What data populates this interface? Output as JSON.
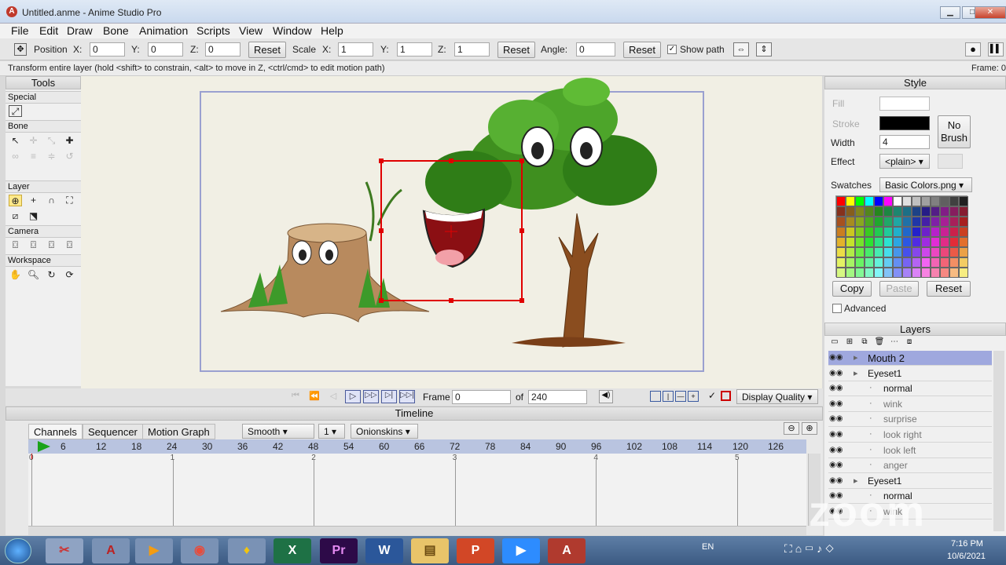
{
  "window": {
    "title": "Untitled.anme - Anime Studio Pro",
    "app_icon_letter": "A",
    "minimize": "▁",
    "maximize": "□",
    "close": "✕"
  },
  "menu": [
    "File",
    "Edit",
    "Draw",
    "Bone",
    "Animation",
    "Scripts",
    "View",
    "Window",
    "Help"
  ],
  "toolbar": {
    "position_label": "Position",
    "x_label": "X:",
    "x_value": "0",
    "y_label": "Y:",
    "y_value": "0",
    "z_label": "Z:",
    "z_value": "0",
    "reset1": "Reset",
    "scale_label": "Scale",
    "sx_label": "X:",
    "sx_value": "1",
    "sy_label": "Y:",
    "sy_value": "1",
    "sz_label": "Z:",
    "sz_value": "1",
    "reset2": "Reset",
    "angle_label": "Angle:",
    "angle_value": "0",
    "reset3": "Reset",
    "show_path": "Show path"
  },
  "status": {
    "hint": "Transform entire layer (hold <shift> to constrain, <alt> to move in Z, <ctrl/cmd> to edit motion path)",
    "frame": "Frame: 0"
  },
  "tools": {
    "title": "Tools",
    "sections": [
      "Special",
      "Bone",
      "Layer",
      "Camera",
      "Workspace"
    ]
  },
  "playback": {
    "frame_label": "Frame",
    "frame_value": "0",
    "of_label": "of",
    "total_value": "240",
    "display_quality": "Display Quality"
  },
  "timeline": {
    "title": "Timeline",
    "tabs": [
      "Channels",
      "Sequencer",
      "Motion Graph"
    ],
    "smooth": "Smooth",
    "step": "1",
    "onionskins": "Onionskins",
    "ruler": [
      "0",
      "6",
      "12",
      "18",
      "24",
      "30",
      "36",
      "42",
      "48",
      "54",
      "60",
      "66",
      "72",
      "78",
      "84",
      "90",
      "96",
      "102",
      "108",
      "114",
      "120",
      "126"
    ],
    "seconds": [
      "0",
      "1",
      "2",
      "3",
      "4",
      "5"
    ]
  },
  "style": {
    "title": "Style",
    "fill_label": "Fill",
    "stroke_label": "Stroke",
    "width_label": "Width",
    "width_value": "4",
    "effect_label": "Effect",
    "effect_value": "<plain>",
    "no_brush": "No Brush",
    "swatches_label": "Swatches",
    "swatches_value": "Basic Colors.png",
    "copy": "Copy",
    "paste": "Paste",
    "reset": "Reset",
    "advanced": "Advanced"
  },
  "layers": {
    "title": "Layers",
    "items": [
      {
        "label": "Mouth 2",
        "type": "group",
        "selected": true
      },
      {
        "label": "Eyeset1",
        "type": "switch"
      },
      {
        "label": "normal",
        "type": "vector",
        "active": true
      },
      {
        "label": "wink",
        "type": "vector"
      },
      {
        "label": "surprise",
        "type": "vector"
      },
      {
        "label": "look right",
        "type": "vector"
      },
      {
        "label": "look left",
        "type": "vector"
      },
      {
        "label": "anger",
        "type": "vector"
      },
      {
        "label": "Eyeset1",
        "type": "switch"
      },
      {
        "label": "normal",
        "type": "vector",
        "active": true
      },
      {
        "label": "wink",
        "type": "vector"
      }
    ]
  },
  "watermark": "zoom",
  "taskbar": {
    "clock_time": "7:16 PM",
    "clock_date": "10/6/2021",
    "lang": "EN"
  }
}
